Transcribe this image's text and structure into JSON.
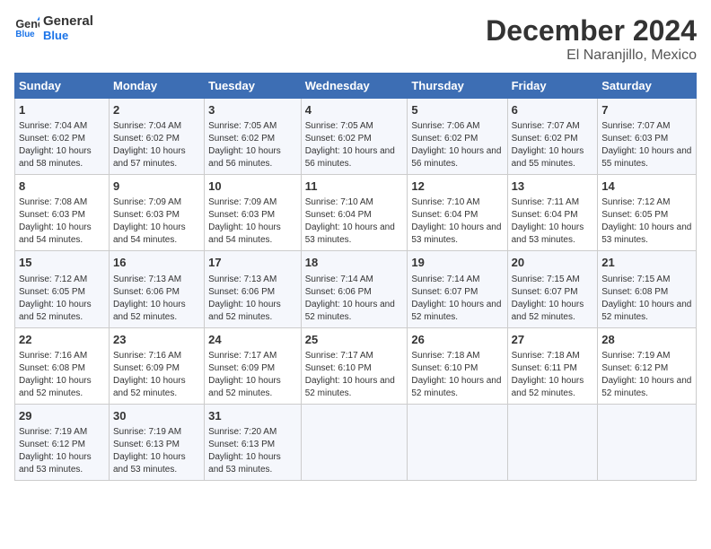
{
  "header": {
    "logo_line1": "General",
    "logo_line2": "Blue",
    "title": "December 2024",
    "subtitle": "El Naranjillo, Mexico"
  },
  "days_of_week": [
    "Sunday",
    "Monday",
    "Tuesday",
    "Wednesday",
    "Thursday",
    "Friday",
    "Saturday"
  ],
  "weeks": [
    [
      {
        "day": "1",
        "sunrise": "7:04 AM",
        "sunset": "6:02 PM",
        "daylight": "10 hours and 58 minutes."
      },
      {
        "day": "2",
        "sunrise": "7:04 AM",
        "sunset": "6:02 PM",
        "daylight": "10 hours and 57 minutes."
      },
      {
        "day": "3",
        "sunrise": "7:05 AM",
        "sunset": "6:02 PM",
        "daylight": "10 hours and 56 minutes."
      },
      {
        "day": "4",
        "sunrise": "7:05 AM",
        "sunset": "6:02 PM",
        "daylight": "10 hours and 56 minutes."
      },
      {
        "day": "5",
        "sunrise": "7:06 AM",
        "sunset": "6:02 PM",
        "daylight": "10 hours and 56 minutes."
      },
      {
        "day": "6",
        "sunrise": "7:07 AM",
        "sunset": "6:02 PM",
        "daylight": "10 hours and 55 minutes."
      },
      {
        "day": "7",
        "sunrise": "7:07 AM",
        "sunset": "6:03 PM",
        "daylight": "10 hours and 55 minutes."
      }
    ],
    [
      {
        "day": "8",
        "sunrise": "7:08 AM",
        "sunset": "6:03 PM",
        "daylight": "10 hours and 54 minutes."
      },
      {
        "day": "9",
        "sunrise": "7:09 AM",
        "sunset": "6:03 PM",
        "daylight": "10 hours and 54 minutes."
      },
      {
        "day": "10",
        "sunrise": "7:09 AM",
        "sunset": "6:03 PM",
        "daylight": "10 hours and 54 minutes."
      },
      {
        "day": "11",
        "sunrise": "7:10 AM",
        "sunset": "6:04 PM",
        "daylight": "10 hours and 53 minutes."
      },
      {
        "day": "12",
        "sunrise": "7:10 AM",
        "sunset": "6:04 PM",
        "daylight": "10 hours and 53 minutes."
      },
      {
        "day": "13",
        "sunrise": "7:11 AM",
        "sunset": "6:04 PM",
        "daylight": "10 hours and 53 minutes."
      },
      {
        "day": "14",
        "sunrise": "7:12 AM",
        "sunset": "6:05 PM",
        "daylight": "10 hours and 53 minutes."
      }
    ],
    [
      {
        "day": "15",
        "sunrise": "7:12 AM",
        "sunset": "6:05 PM",
        "daylight": "10 hours and 52 minutes."
      },
      {
        "day": "16",
        "sunrise": "7:13 AM",
        "sunset": "6:06 PM",
        "daylight": "10 hours and 52 minutes."
      },
      {
        "day": "17",
        "sunrise": "7:13 AM",
        "sunset": "6:06 PM",
        "daylight": "10 hours and 52 minutes."
      },
      {
        "day": "18",
        "sunrise": "7:14 AM",
        "sunset": "6:06 PM",
        "daylight": "10 hours and 52 minutes."
      },
      {
        "day": "19",
        "sunrise": "7:14 AM",
        "sunset": "6:07 PM",
        "daylight": "10 hours and 52 minutes."
      },
      {
        "day": "20",
        "sunrise": "7:15 AM",
        "sunset": "6:07 PM",
        "daylight": "10 hours and 52 minutes."
      },
      {
        "day": "21",
        "sunrise": "7:15 AM",
        "sunset": "6:08 PM",
        "daylight": "10 hours and 52 minutes."
      }
    ],
    [
      {
        "day": "22",
        "sunrise": "7:16 AM",
        "sunset": "6:08 PM",
        "daylight": "10 hours and 52 minutes."
      },
      {
        "day": "23",
        "sunrise": "7:16 AM",
        "sunset": "6:09 PM",
        "daylight": "10 hours and 52 minutes."
      },
      {
        "day": "24",
        "sunrise": "7:17 AM",
        "sunset": "6:09 PM",
        "daylight": "10 hours and 52 minutes."
      },
      {
        "day": "25",
        "sunrise": "7:17 AM",
        "sunset": "6:10 PM",
        "daylight": "10 hours and 52 minutes."
      },
      {
        "day": "26",
        "sunrise": "7:18 AM",
        "sunset": "6:10 PM",
        "daylight": "10 hours and 52 minutes."
      },
      {
        "day": "27",
        "sunrise": "7:18 AM",
        "sunset": "6:11 PM",
        "daylight": "10 hours and 52 minutes."
      },
      {
        "day": "28",
        "sunrise": "7:19 AM",
        "sunset": "6:12 PM",
        "daylight": "10 hours and 52 minutes."
      }
    ],
    [
      {
        "day": "29",
        "sunrise": "7:19 AM",
        "sunset": "6:12 PM",
        "daylight": "10 hours and 53 minutes."
      },
      {
        "day": "30",
        "sunrise": "7:19 AM",
        "sunset": "6:13 PM",
        "daylight": "10 hours and 53 minutes."
      },
      {
        "day": "31",
        "sunrise": "7:20 AM",
        "sunset": "6:13 PM",
        "daylight": "10 hours and 53 minutes."
      },
      null,
      null,
      null,
      null
    ]
  ]
}
